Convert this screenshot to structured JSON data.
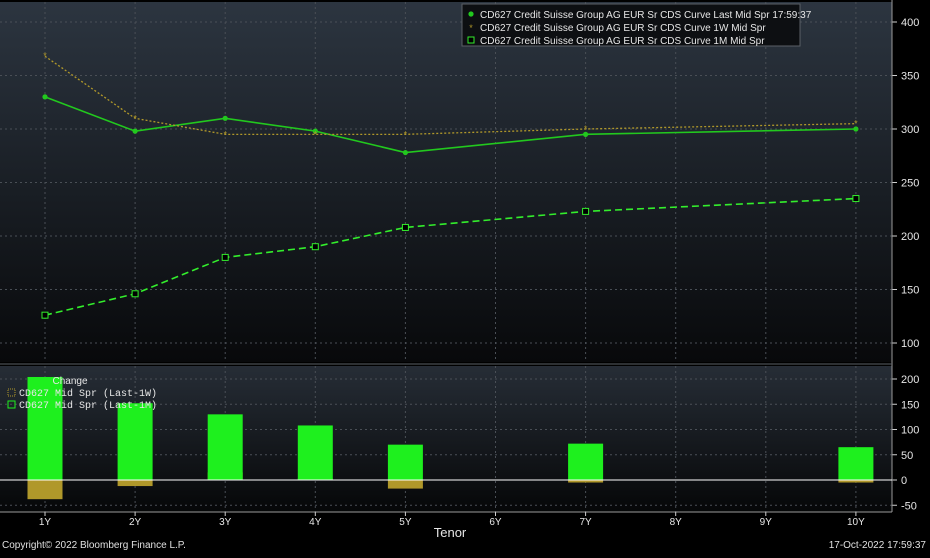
{
  "chart_data": [
    {
      "type": "line",
      "panel": "top",
      "x": [
        "1Y",
        "2Y",
        "3Y",
        "4Y",
        "5Y",
        "6Y",
        "7Y",
        "8Y",
        "9Y",
        "10Y"
      ],
      "x_positions_years": [
        1,
        2,
        3,
        4,
        5,
        7,
        10
      ],
      "series": [
        {
          "name": "CD627 Credit Suisse Group AG EUR Sr CDS Curve Last Mid Spr 17:59:37",
          "color": "#22c81e",
          "style": "solid",
          "marker": "dot",
          "points": [
            [
              1,
              330
            ],
            [
              2,
              298
            ],
            [
              3,
              310
            ],
            [
              4,
              298
            ],
            [
              5,
              278
            ],
            [
              7,
              295
            ],
            [
              10,
              300
            ]
          ]
        },
        {
          "name": "CD627 Credit Suisse Group AG EUR Sr CDS Curve 1W Mid Spr",
          "color": "#b0982a",
          "style": "dotted",
          "marker": "star",
          "points": [
            [
              1,
              368
            ],
            [
              2,
              310
            ],
            [
              3,
              295
            ],
            [
              4,
              295
            ],
            [
              5,
              295
            ],
            [
              7,
              300
            ],
            [
              10,
              305
            ]
          ]
        },
        {
          "name": "CD627 Credit Suisse Group AG EUR Sr CDS Curve 1M Mid Spr",
          "color": "#33ee2c",
          "style": "dashed",
          "marker": "square",
          "points": [
            [
              1,
              126
            ],
            [
              2,
              146
            ],
            [
              3,
              180
            ],
            [
              4,
              190
            ],
            [
              5,
              208
            ],
            [
              7,
              223
            ],
            [
              10,
              235
            ]
          ]
        }
      ],
      "ylim": [
        80,
        420
      ],
      "yticks": [
        100,
        150,
        200,
        250,
        300,
        350,
        400
      ],
      "legend_position": "top-right",
      "grid": true
    },
    {
      "type": "bar",
      "panel": "bottom",
      "title": "Change",
      "x": [
        "1Y",
        "2Y",
        "3Y",
        "4Y",
        "5Y",
        "6Y",
        "7Y",
        "8Y",
        "9Y",
        "10Y"
      ],
      "series": [
        {
          "name": "CD627 Mid Spr (Last-1W)",
          "color": "#b0982a",
          "points": [
            [
              1,
              -38
            ],
            [
              2,
              -12
            ],
            [
              3,
              15
            ],
            [
              4,
              3
            ],
            [
              5,
              -17
            ],
            [
              7,
              -5
            ],
            [
              10,
              -5
            ]
          ]
        },
        {
          "name": "CD627 Mid Spr (Last-1M)",
          "color": "#1ef01e",
          "points": [
            [
              1,
              204
            ],
            [
              2,
              152
            ],
            [
              3,
              130
            ],
            [
              4,
              108
            ],
            [
              5,
              70
            ],
            [
              7,
              72
            ],
            [
              10,
              65
            ]
          ]
        }
      ],
      "ylim": [
        -60,
        220
      ],
      "yticks": [
        -50,
        0,
        50,
        100,
        150,
        200
      ],
      "xlabel": "Tenor",
      "legend_position": "top-left",
      "grid": true
    }
  ],
  "footer": {
    "copyright": "Copyright© 2022 Bloomberg Finance L.P.",
    "timestamp": "17-Oct-2022 17:59:37"
  }
}
